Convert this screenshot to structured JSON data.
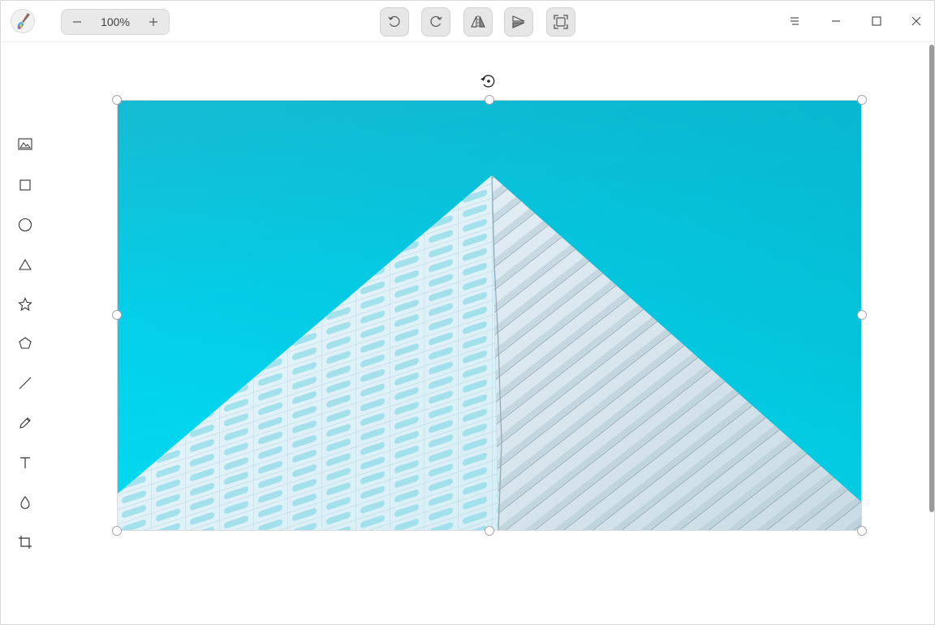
{
  "app": {
    "logo_icon": "paintbrush-icon"
  },
  "zoom": {
    "value": "100%",
    "minus_icon": "minus-icon",
    "plus_icon": "plus-icon"
  },
  "header_tools": [
    {
      "name": "rotate-left-button",
      "icon": "rotate-ccw-icon"
    },
    {
      "name": "rotate-right-button",
      "icon": "rotate-cw-icon"
    },
    {
      "name": "flip-horizontal-button",
      "icon": "flip-horizontal-icon"
    },
    {
      "name": "flip-vertical-button",
      "icon": "flip-vertical-icon"
    },
    {
      "name": "fit-window-button",
      "icon": "fit-window-icon"
    }
  ],
  "window_controls": [
    "menu-icon",
    "minimize-icon",
    "maximize-icon",
    "close-icon"
  ],
  "left_tools": [
    "image-icon",
    "rectangle-icon",
    "ellipse-icon",
    "triangle-icon",
    "star-icon",
    "polygon-icon",
    "line-icon",
    "pencil-icon",
    "text-icon",
    "blur-icon",
    "crop-icon"
  ],
  "colors": {
    "sky_top": "#14c3d9",
    "sky_bottom": "#00d9f0",
    "building": "#e6f3f8"
  }
}
